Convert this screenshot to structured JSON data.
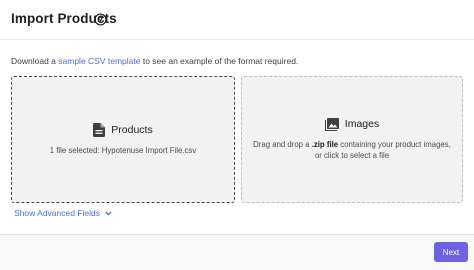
{
  "header": {
    "title": "Import Products",
    "help_icon": "help-circle-icon"
  },
  "description": {
    "before": "Download a ",
    "link": "sample CSV template",
    "after": " to see an example of the format required."
  },
  "dropzones": {
    "products": {
      "icon": "document-icon",
      "label": "Products",
      "status": "1 file selected: Hypotenuse Import File.csv"
    },
    "images": {
      "icon": "image-icon",
      "label": "Images",
      "line1_before": "Drag and drop a ",
      "line1_bold": ".zip file",
      "line1_after": " containing your product images,",
      "line2": "or click to select a file"
    }
  },
  "advanced": {
    "label": "Show Advanced Fields",
    "icon": "chevron-down-icon"
  },
  "footer": {
    "next_label": "Next",
    "accent_color": "#6c62e2"
  }
}
